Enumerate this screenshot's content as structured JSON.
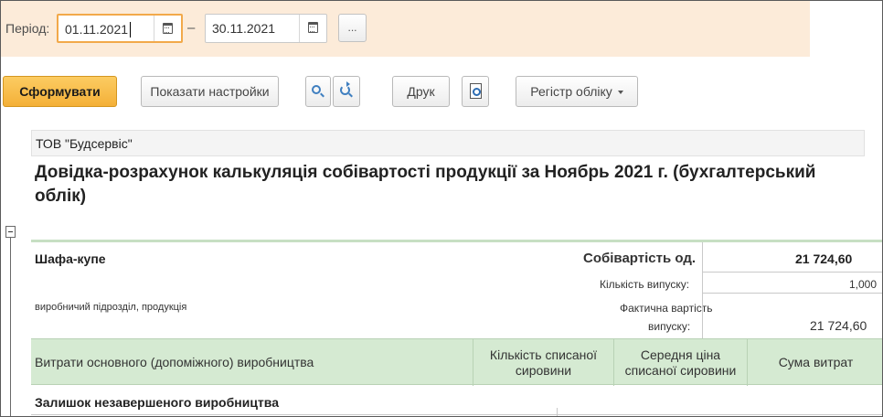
{
  "period": {
    "label": "Період:",
    "date_from": "01.11.2021",
    "date_to": "30.11.2021",
    "dash": "–",
    "more_label": "..."
  },
  "toolbar": {
    "generate_label": "Сформувати",
    "settings_label": "Показати настройки",
    "print_label": "Друк",
    "register_label": "Регістр обліку"
  },
  "report": {
    "company": "ТОВ \"Будсервіс\"",
    "title": "Довідка-розрахунок калькуляція собівартості продукції  за Ноябрь 2021 г. (бухгалтерський облік)",
    "product": {
      "name": "Шафа-купе",
      "subtitle": "виробничий підрозділ, продукція",
      "unit_cost_label": "Собівартість од.",
      "unit_cost_value": "21 724,60",
      "output_qty_label": "Кількість випуску:",
      "output_qty_value": "1,000",
      "actual_cost_label_1": "Фактична вартість",
      "actual_cost_label_2": "випуску:",
      "actual_cost_value": "21 724,60"
    },
    "columns": [
      {
        "label": "Витрати основного (допоміжного) виробництва"
      },
      {
        "label": "Кількість списаної сировини"
      },
      {
        "label": "Середня ціна списаної сировини"
      },
      {
        "label": "Сума витрат"
      }
    ],
    "rows": [
      {
        "label": "Залишок незавершеного виробництва"
      }
    ]
  },
  "colors": {
    "period_bg": "#fcebd9",
    "primary_button": "#f4b038",
    "header_green": "#d5ead2",
    "active_field_border": "#f2a94a"
  }
}
